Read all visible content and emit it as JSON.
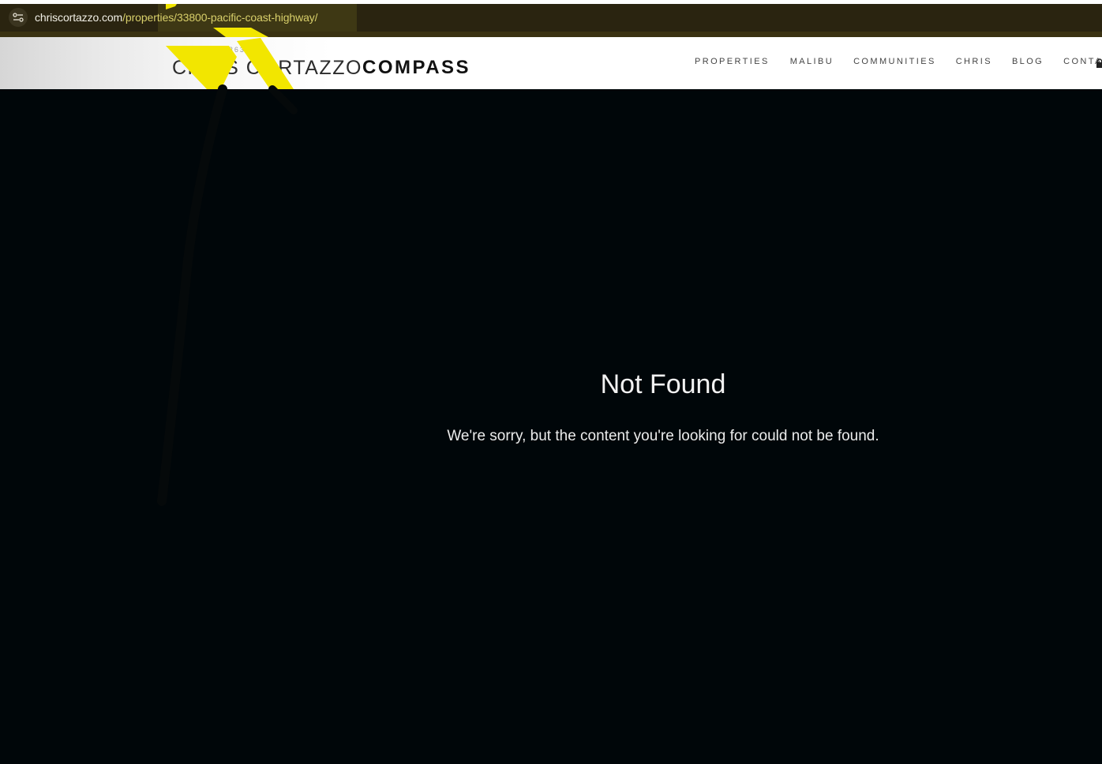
{
  "browser": {
    "url_domain": "chriscortazzo.com",
    "url_path": "/properties/33800-pacific-coast-highway/"
  },
  "header": {
    "dre": "DRE# 01190363",
    "brand_name": "CHRIS CORTAZZO",
    "brokerage_logo": "COMPASS",
    "nav": [
      "PROPERTIES",
      "MALIBU",
      "COMMUNITIES",
      "CHRIS",
      "BLOG",
      "CONTACT"
    ]
  },
  "main": {
    "title": "Not Found",
    "message": "We're sorry, but the content you're looking for could not be found."
  },
  "icons": {
    "site_info": "tune-icon",
    "login": "lock-icon"
  },
  "colors": {
    "page_background": "#000609",
    "address_bar": "#2a2410",
    "annotation_highlight": "#f2e600"
  }
}
